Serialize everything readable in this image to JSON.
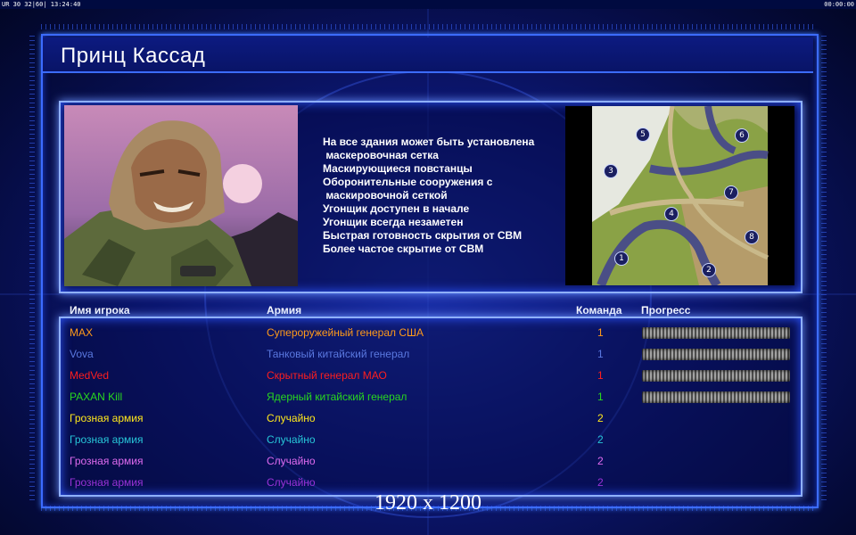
{
  "hud": {
    "left": "UR 30 32|60| 13:24:40",
    "right": "00:00:00"
  },
  "title": "Принц Кассад",
  "features": [
    "На все здания может быть установлена",
    " маскеровочная сетка",
    "Маскирующиеся повстанцы",
    "Оборонительные сооружения с",
    " маскировочной сеткой",
    "Угонщик доступен в начале",
    "Угонщик всегда незаметен",
    "Быстрая готовность скрытия от СВМ",
    "Более частое скрытие от СВМ"
  ],
  "map_markers": [
    "1",
    "2",
    "3",
    "4",
    "5",
    "6",
    "7",
    "8"
  ],
  "columns": {
    "player": "Имя игрока",
    "army": "Армия",
    "team": "Команда",
    "progress": "Прогресс"
  },
  "players": [
    {
      "name": "MAX",
      "army": "Супероружейный генерал США",
      "team": "1",
      "color": "#ff9a1a",
      "progress": 1
    },
    {
      "name": "Vova",
      "army": "Танковый китайский генерал",
      "team": "1",
      "color": "#5a78e0",
      "progress": 1
    },
    {
      "name": "MedVed",
      "army": "Скрытный генерал МАО",
      "team": "1",
      "color": "#ff1e1e",
      "progress": 1
    },
    {
      "name": "PAXAN Kill",
      "army": "Ядерный китайский генерал",
      "team": "1",
      "color": "#29d81e",
      "progress": 1
    },
    {
      "name": "Грозная армия",
      "army": "Случайно",
      "team": "2",
      "color": "#ffe81c",
      "progress": null
    },
    {
      "name": "Грозная армия",
      "army": "Случайно",
      "team": "2",
      "color": "#27c6d8",
      "progress": null
    },
    {
      "name": "Грозная армия",
      "army": "Случайно",
      "team": "2",
      "color": "#e06bf0",
      "progress": null
    },
    {
      "name": "Грозная армия",
      "army": "Случайно",
      "team": "2",
      "color": "#9a32d8",
      "progress": null
    }
  ],
  "resolution": "1920 x 1200"
}
